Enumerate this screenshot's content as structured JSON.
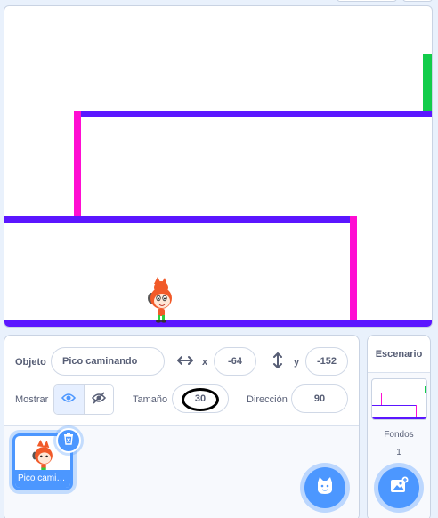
{
  "sprite_info": {
    "sprite_label": "Objeto",
    "sprite_name": "Pico caminando",
    "x_label": "x",
    "x_value": "-64",
    "y_label": "y",
    "y_value": "-152",
    "show_label": "Mostrar",
    "size_label": "Tamaño",
    "size_value": "30",
    "direction_label": "Dirección",
    "direction_value": "90"
  },
  "sprite_list": {
    "items": [
      {
        "name": "Pico cami…"
      }
    ]
  },
  "stage_selector": {
    "title": "Escenario",
    "backdrops_label": "Fondos",
    "backdrops_count": "1"
  },
  "icons": {
    "x_axis": "horizontal-arrows-icon",
    "y_axis": "vertical-arrows-icon",
    "show": "eye-icon",
    "hide": "eye-slash-icon",
    "delete": "trash-icon",
    "add_sprite": "cat-plus-icon",
    "add_backdrop": "image-plus-icon"
  },
  "colors": {
    "accent": "#4c97ff",
    "platform": "#5b16ff",
    "wall": "#ff0dd2",
    "goal": "#12cc4a",
    "highlight_ring": "#000000"
  }
}
